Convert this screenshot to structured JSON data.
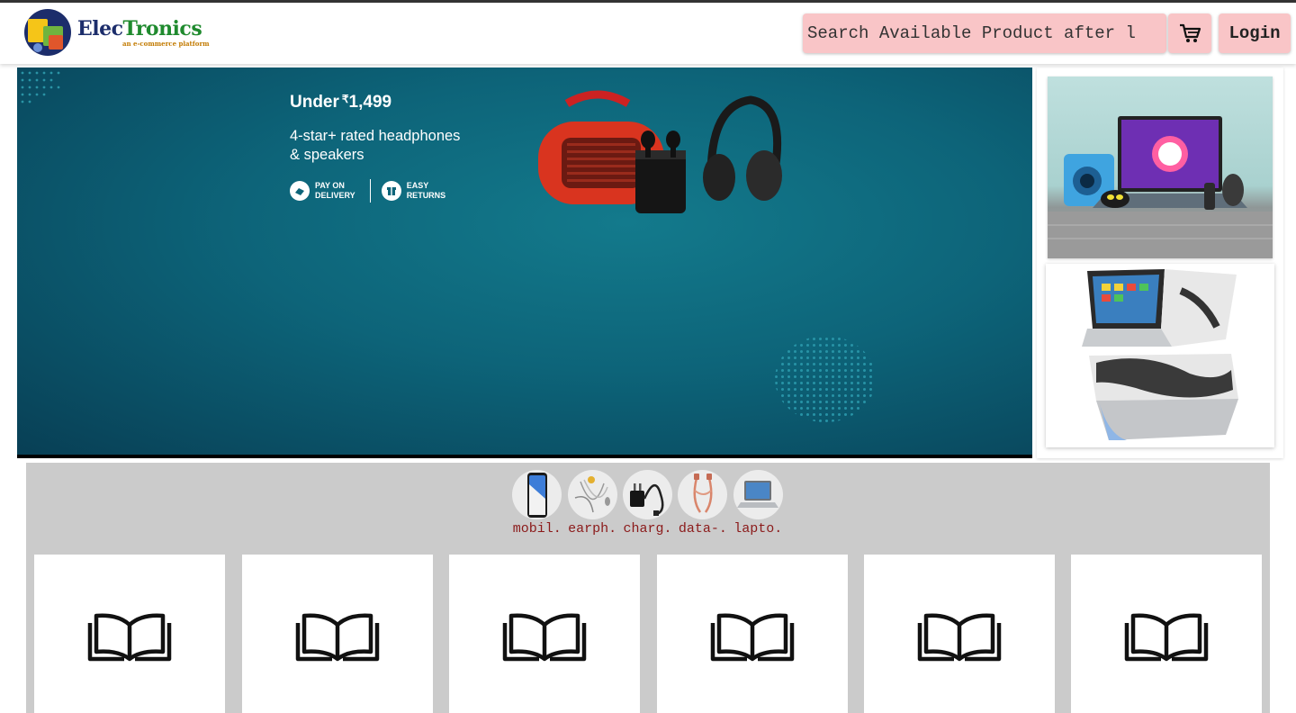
{
  "header": {
    "logo": {
      "title_part1": "Elec",
      "title_part2": "Tronics",
      "tagline": "an e-commerce platform"
    },
    "search": {
      "placeholder": "Search  Available Product after l"
    },
    "cart_icon": "cart-icon",
    "login_label": "Login"
  },
  "hero": {
    "price_prefix": "Under",
    "price_symbol": "₹",
    "price_value": "1,499",
    "line1": "4-star+ rated headphones",
    "line2": "& speakers",
    "badge1_line1": "PAY ON",
    "badge1_line2": "DELIVERY",
    "badge2_line1": "EASY",
    "badge2_line2": "RETURNS"
  },
  "categories": [
    {
      "label": "mobil.",
      "icon": "mobile-icon"
    },
    {
      "label": "earph.",
      "icon": "earphones-icon"
    },
    {
      "label": "charg.",
      "icon": "charger-icon"
    },
    {
      "label": "data-.",
      "icon": "data-cable-icon"
    },
    {
      "label": "lapto.",
      "icon": "laptop-icon"
    }
  ],
  "products": [
    {
      "icon": "book-open-icon"
    },
    {
      "icon": "book-open-icon"
    },
    {
      "icon": "book-open-icon"
    },
    {
      "icon": "book-open-icon"
    },
    {
      "icon": "book-open-icon"
    },
    {
      "icon": "book-open-icon"
    }
  ],
  "colors": {
    "accent_pink": "#f9c5c7",
    "hero_teal": "#0d6479",
    "category_bg": "#cbcbcb",
    "category_label": "#8b1a1a"
  }
}
